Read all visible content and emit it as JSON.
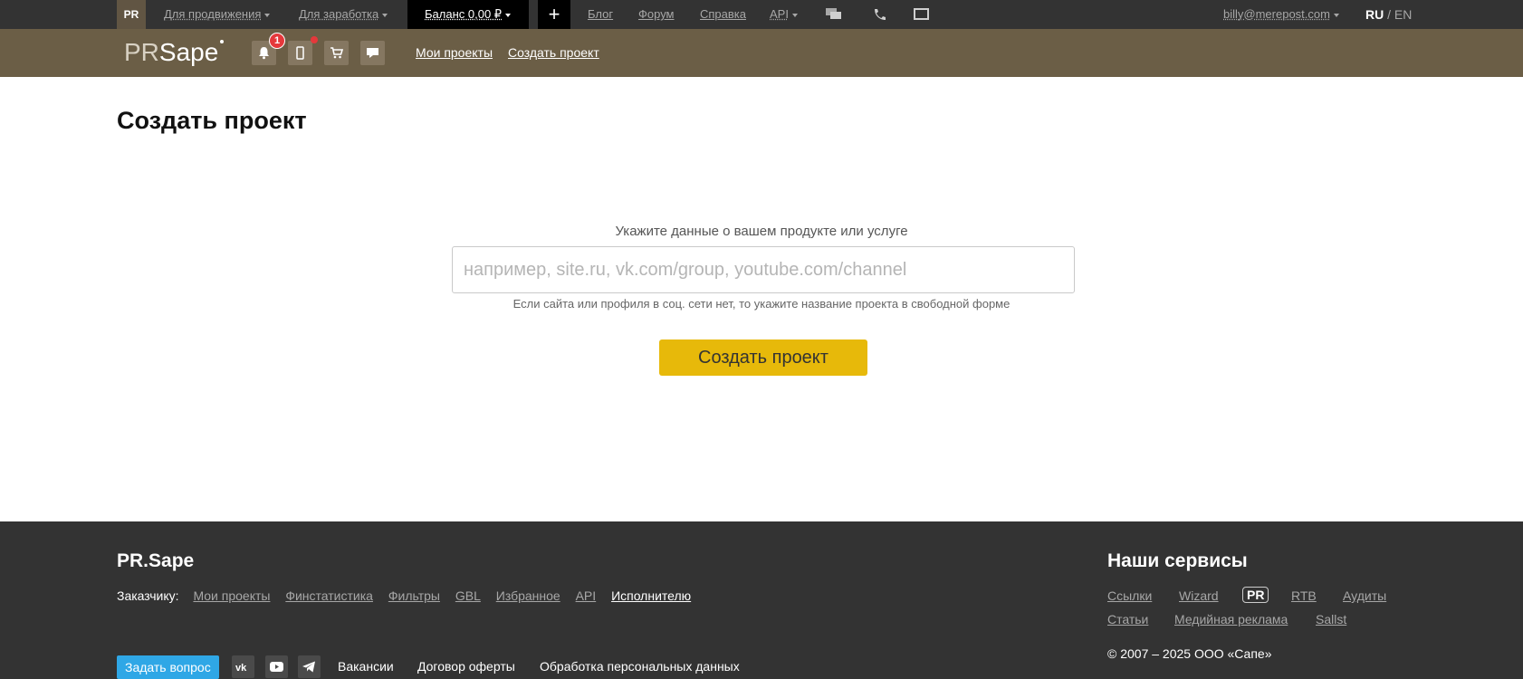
{
  "topbar": {
    "pr_badge": "PR",
    "promo_label": "Для продвижения",
    "earn_label": "Для заработка",
    "balance_label": "Баланс 0,00 ₽",
    "plus_label": "+",
    "blog_label": "Блог",
    "forum_label": "Форум",
    "help_label": "Справка",
    "api_label": "API",
    "user_email": "billy@merepost.com",
    "lang_active": "RU",
    "lang_sep": " / ",
    "lang_other": "EN"
  },
  "navbar": {
    "logo_pr": "PR",
    "logo_sape": "Sape",
    "notification_count": "1",
    "my_projects_label": "Мои проекты",
    "create_project_label": "Создать проект"
  },
  "main": {
    "title": "Создать проект",
    "form_label": "Укажите данные о вашем продукте или услуге",
    "input_placeholder": "например, site.ru, vk.com/group, youtube.com/channel",
    "input_value": "",
    "hint": "Если сайта или профиля в соц. сети нет, то укажите название проекта в свободной форме",
    "submit_label": "Создать проект"
  },
  "footer": {
    "brand": "PR.Sape",
    "customer_label": "Заказчику:",
    "customer_links": [
      "Мои проекты",
      "Финстатистика",
      "Фильтры",
      "GBL",
      "Избранное",
      "API"
    ],
    "performer_label": "Исполнителю",
    "ask_label": "Задать вопрос",
    "vacancies_label": "Вакансии",
    "offer_label": "Договор оферты",
    "personal_data_label": "Обработка персональных данных",
    "services_title": "Наши сервисы",
    "services": [
      "Ссылки",
      "Wizard",
      "PR",
      "RTB",
      "Аудиты",
      "Статьи",
      "Медийная реклама",
      "Sallst"
    ],
    "copyright": "© 2007 – 2025 ООО «Сапе»"
  },
  "colors": {
    "topbar_bg": "#333333",
    "navbar_bg": "#6b5e46",
    "accent_button": "#e7b90a",
    "ask_button": "#2fa7e6",
    "badge": "#e5383b"
  },
  "icons": {
    "bell": "bell-icon",
    "mobile": "mobile-icon",
    "cart": "cart-icon",
    "messages": "chat-icon",
    "chat_top": "chat-bubbles-icon",
    "phone": "phone-icon",
    "monitor": "monitor-icon",
    "vk": "vk-icon",
    "youtube": "youtube-icon",
    "telegram": "telegram-icon"
  }
}
